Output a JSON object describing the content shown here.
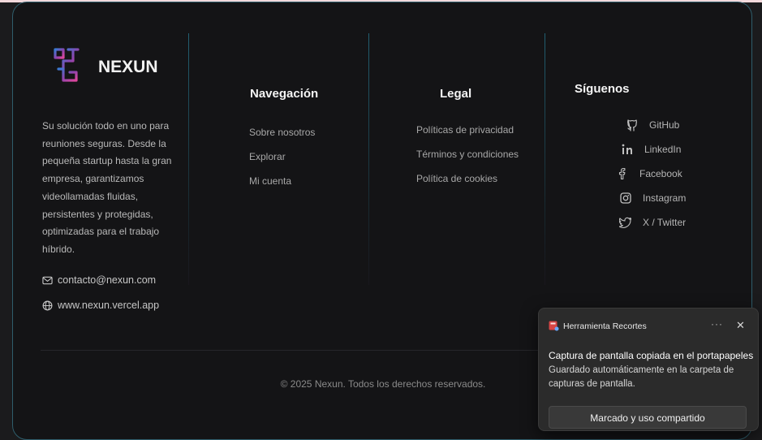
{
  "brand": {
    "name": "NEXUN",
    "description": "Su solución todo en uno para reuniones seguras. Desde la pequeña startup hasta la gran empresa, garantizamos videollamadas fluidas, persistentes y protegidas, optimizadas para el trabajo híbrido.",
    "email": "contacto@nexun.com",
    "website": "www.nexun.vercel.app"
  },
  "navigation": {
    "title": "Navegación",
    "links": [
      "Sobre nosotros",
      "Explorar",
      "Mi cuenta"
    ]
  },
  "legal": {
    "title": "Legal",
    "links": [
      "Políticas de privacidad",
      "Términos y condiciones",
      "Política de cookies"
    ]
  },
  "social": {
    "title": "Síguenos",
    "items": [
      {
        "label": "GitHub",
        "icon": "github-icon"
      },
      {
        "label": "LinkedIn",
        "icon": "linkedin-icon"
      },
      {
        "label": "Facebook",
        "icon": "facebook-icon"
      },
      {
        "label": "Instagram",
        "icon": "instagram-icon"
      },
      {
        "label": "X / Twitter",
        "icon": "twitter-icon"
      }
    ]
  },
  "footer": {
    "copyright": "© 2025 Nexun. Todos los derechos reservados."
  },
  "toast": {
    "app_name": "Herramienta Recortes",
    "more": "···",
    "close": "✕",
    "title": "Captura de pantalla copiada en el portapapeles",
    "body": "Guardado automáticamente en la carpeta de capturas de pantalla.",
    "button": "Marcado y uso compartido"
  },
  "colors": {
    "accent_border": "#2f5d6b",
    "background": "#141416",
    "logo_gradient": [
      "#3a7bd5",
      "#8e44ad",
      "#e0469c"
    ]
  }
}
